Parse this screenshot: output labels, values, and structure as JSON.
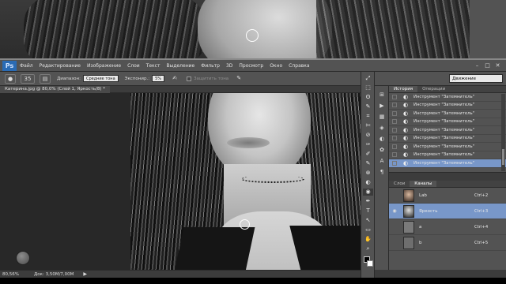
{
  "menubar": {
    "logo": "Ps",
    "items": [
      "Файл",
      "Редактирование",
      "Изображение",
      "Слои",
      "Текст",
      "Выделение",
      "Фильтр",
      "3D",
      "Просмотр",
      "Окно",
      "Справка"
    ],
    "win_controls": [
      "–",
      "□",
      "✕"
    ]
  },
  "options": {
    "brush_size": "35",
    "range_label": "Диапазон:",
    "range_value": "Средние тона",
    "exposure_label": "Экспонир.:",
    "exposure_value": "5%",
    "protect_label": "Защитить тона",
    "workspace": "Движение"
  },
  "document": {
    "tab_title": "Катерина.jpg @ 80,0% (Слой 1, Яркость/8) *",
    "zoom": "80,56%",
    "doc_info": "Док: 3,50M/7,00M"
  },
  "tools": [
    "⤢",
    "⬚",
    "ʘ",
    "✎",
    "⌗",
    "✄",
    "⊘",
    "✑",
    "✐",
    "✎",
    "⊗",
    "◐",
    "◉",
    "✒",
    "T",
    "↖",
    "▭",
    "✋",
    "⌕"
  ],
  "history": {
    "tabs": [
      "История",
      "Операции"
    ],
    "items": [
      "Инструмент \"Затемнитель\"",
      "Инструмент \"Затемнитель\"",
      "Инструмент \"Затемнитель\"",
      "Инструмент \"Затемнитель\"",
      "Инструмент \"Затемнитель\"",
      "Инструмент \"Затемнитель\"",
      "Инструмент \"Затемнитель\"",
      "Инструмент \"Затемнитель\"",
      "Инструмент \"Затемнитель\""
    ]
  },
  "channels": {
    "tabs": [
      "Слои",
      "Каналы"
    ],
    "rows": [
      {
        "name": "Lab",
        "key": "Ctrl+2"
      },
      {
        "name": "Яркость",
        "key": "Ctrl+3"
      },
      {
        "name": "a",
        "key": "Ctrl+4"
      },
      {
        "name": "b",
        "key": "Ctrl+5"
      }
    ]
  },
  "top_tools": [
    "✎",
    "▮",
    "T"
  ]
}
